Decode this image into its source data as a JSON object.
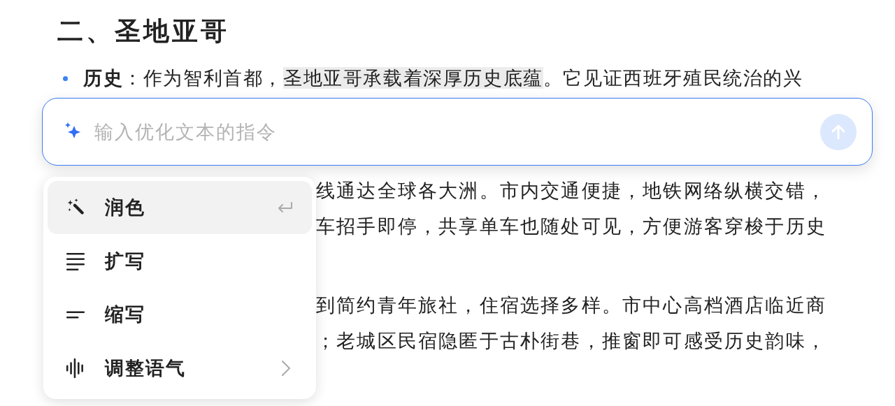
{
  "document": {
    "heading": "二、圣地亚哥",
    "bullet": {
      "label": "历史",
      "separator": "：",
      "parts": [
        {
          "text": "作为智利首都，",
          "highlighted": false
        },
        {
          "text": "圣地亚哥承载着深厚历史底蕴",
          "highlighted": true
        },
        {
          "text": "。它见证西班牙殖民统治的兴",
          "highlighted": false
        }
      ]
    },
    "fragments": [
      [
        "线通达全球各大洲。市内交通便捷，地铁网络纵横交错，",
        "车招手即停，共享单车也随处可见，方便游客穿梭于历史"
      ],
      [
        "到简约青年旅社，住宿选择多样。市中心高档酒店临近商",
        "；老城区民宿隐匿于古朴街巷，推窗即可感受历史韵味，"
      ]
    ]
  },
  "prompt": {
    "placeholder": "输入优化文本的指令"
  },
  "menu": {
    "items": [
      {
        "kind": "polish",
        "label": "润色",
        "selected": true,
        "submenu": false
      },
      {
        "kind": "expand",
        "label": "扩写",
        "selected": false,
        "submenu": false
      },
      {
        "kind": "shorten",
        "label": "缩写",
        "selected": false,
        "submenu": false
      },
      {
        "kind": "tone",
        "label": "调整语气",
        "selected": false,
        "submenu": true
      }
    ]
  }
}
